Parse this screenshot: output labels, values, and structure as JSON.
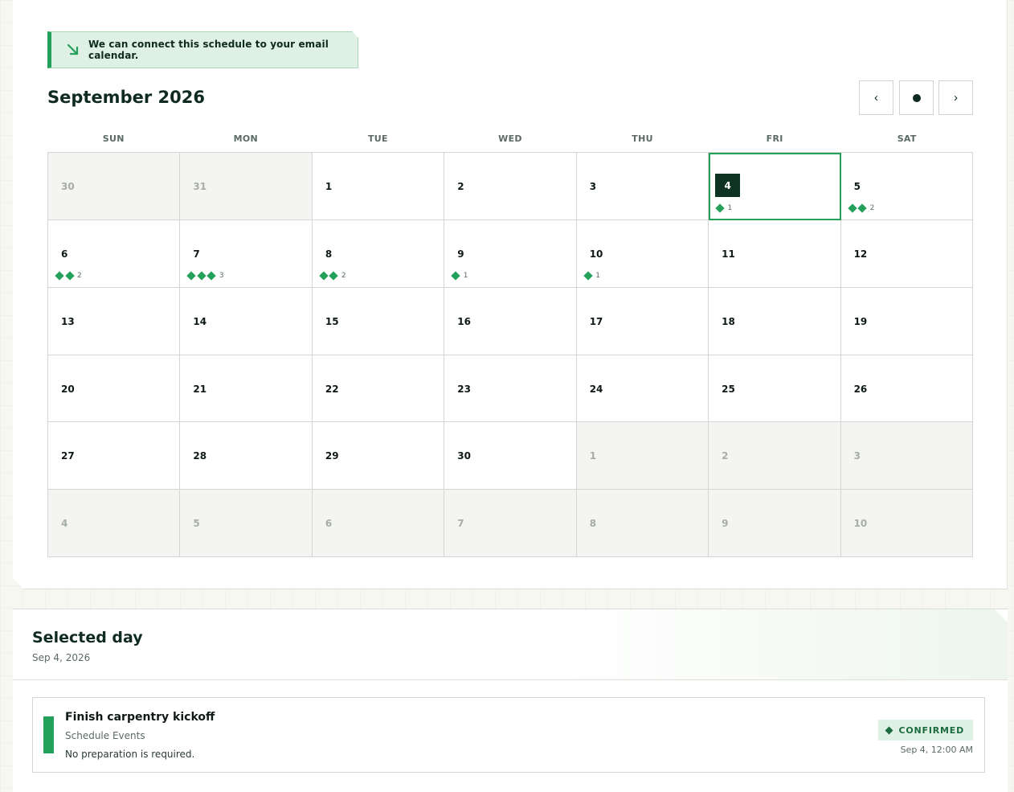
{
  "notice": {
    "icon": "arrow-down-right-icon",
    "text": "We can connect this schedule to your email calendar."
  },
  "calendar": {
    "month_title": "September 2026",
    "nav": {
      "prev_label": "‹",
      "today_icon": "dot-icon",
      "next_label": "›"
    },
    "weekdays": [
      "SUN",
      "MON",
      "TUE",
      "WED",
      "THU",
      "FRI",
      "SAT"
    ],
    "accent_color": "#23a059",
    "selected_day": "4",
    "weeks": [
      [
        {
          "day": "30",
          "outside": true,
          "events": 0
        },
        {
          "day": "31",
          "outside": true,
          "events": 0
        },
        {
          "day": "1",
          "outside": false,
          "events": 0
        },
        {
          "day": "2",
          "outside": false,
          "events": 0
        },
        {
          "day": "3",
          "outside": false,
          "events": 0
        },
        {
          "day": "4",
          "outside": false,
          "events": 1,
          "selected": true
        },
        {
          "day": "5",
          "outside": false,
          "events": 2
        }
      ],
      [
        {
          "day": "6",
          "outside": false,
          "events": 2
        },
        {
          "day": "7",
          "outside": false,
          "events": 3
        },
        {
          "day": "8",
          "outside": false,
          "events": 2
        },
        {
          "day": "9",
          "outside": false,
          "events": 1
        },
        {
          "day": "10",
          "outside": false,
          "events": 1
        },
        {
          "day": "11",
          "outside": false,
          "events": 0
        },
        {
          "day": "12",
          "outside": false,
          "events": 0
        }
      ],
      [
        {
          "day": "13",
          "outside": false,
          "events": 0
        },
        {
          "day": "14",
          "outside": false,
          "events": 0
        },
        {
          "day": "15",
          "outside": false,
          "events": 0
        },
        {
          "day": "16",
          "outside": false,
          "events": 0
        },
        {
          "day": "17",
          "outside": false,
          "events": 0
        },
        {
          "day": "18",
          "outside": false,
          "events": 0
        },
        {
          "day": "19",
          "outside": false,
          "events": 0
        }
      ],
      [
        {
          "day": "20",
          "outside": false,
          "events": 0
        },
        {
          "day": "21",
          "outside": false,
          "events": 0
        },
        {
          "day": "22",
          "outside": false,
          "events": 0
        },
        {
          "day": "23",
          "outside": false,
          "events": 0
        },
        {
          "day": "24",
          "outside": false,
          "events": 0
        },
        {
          "day": "25",
          "outside": false,
          "events": 0
        },
        {
          "day": "26",
          "outside": false,
          "events": 0
        }
      ],
      [
        {
          "day": "27",
          "outside": false,
          "events": 0
        },
        {
          "day": "28",
          "outside": false,
          "events": 0
        },
        {
          "day": "29",
          "outside": false,
          "events": 0
        },
        {
          "day": "30",
          "outside": false,
          "events": 0
        },
        {
          "day": "1",
          "outside": true,
          "events": 0
        },
        {
          "day": "2",
          "outside": true,
          "events": 0
        },
        {
          "day": "3",
          "outside": true,
          "events": 0
        }
      ],
      [
        {
          "day": "4",
          "outside": true,
          "events": 0
        },
        {
          "day": "5",
          "outside": true,
          "events": 0
        },
        {
          "day": "6",
          "outside": true,
          "events": 0
        },
        {
          "day": "7",
          "outside": true,
          "events": 0
        },
        {
          "day": "8",
          "outside": true,
          "events": 0
        },
        {
          "day": "9",
          "outside": true,
          "events": 0
        },
        {
          "day": "10",
          "outside": true,
          "events": 0
        }
      ]
    ]
  },
  "selected": {
    "title": "Selected day",
    "date": "Sep 4, 2026",
    "events": [
      {
        "title": "Finish carpentry kickoff",
        "category": "Schedule Events",
        "note": "No preparation is required.",
        "status": "CONFIRMED",
        "time": "Sep 4, 12:00 AM",
        "color": "#23a059"
      }
    ]
  }
}
